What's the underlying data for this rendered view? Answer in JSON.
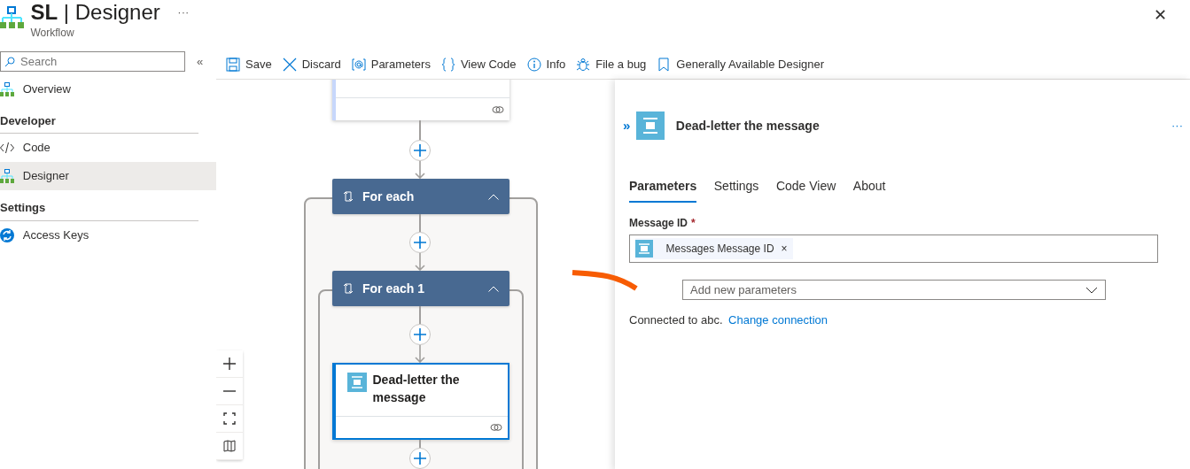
{
  "header": {
    "title_bold": "SL",
    "title_rest": "| Designer",
    "subtitle": "Workflow",
    "more": "···",
    "close": "✕"
  },
  "sidebar": {
    "search_placeholder": "Search",
    "collapse": "«",
    "sections": [
      {
        "items": [
          {
            "label": "Overview",
            "kind": "workflow",
            "selected": false
          }
        ]
      },
      {
        "heading": "Developer",
        "items": [
          {
            "label": "Code",
            "kind": "code",
            "selected": false
          },
          {
            "label": "Designer",
            "kind": "workflow",
            "selected": true
          }
        ]
      },
      {
        "heading": "Settings",
        "items": [
          {
            "label": "Access Keys",
            "kind": "refresh",
            "selected": false
          }
        ]
      }
    ]
  },
  "toolbar": [
    {
      "label": "Save",
      "kind": "save"
    },
    {
      "label": "Discard",
      "kind": "close"
    },
    {
      "label": "Parameters",
      "kind": "at"
    },
    {
      "label": "View Code",
      "kind": "braces"
    },
    {
      "label": "Info",
      "kind": "info"
    },
    {
      "label": "File a bug",
      "kind": "bug"
    },
    {
      "label": "Generally Available Designer",
      "kind": "bookmark"
    }
  ],
  "canvas": {
    "loops": [
      {
        "title": "For each",
        "expanded": true
      },
      {
        "title": "For each 1",
        "expanded": true
      }
    ],
    "action": {
      "title": "Dead-letter the message",
      "selected": true
    }
  },
  "panel": {
    "collapse": "»",
    "title": "Dead-letter the message",
    "more": "···",
    "tabs": [
      {
        "label": "Parameters",
        "selected": true
      },
      {
        "label": "Settings",
        "selected": false
      },
      {
        "label": "Code View",
        "selected": false
      },
      {
        "label": "About",
        "selected": false
      }
    ],
    "field": {
      "label": "Message ID",
      "required_mark": "*",
      "token": "Messages Message ID",
      "remove": "×"
    },
    "add_params_placeholder": "Add new parameters",
    "connection_text": "Connected to abc.",
    "connection_link": "Change connection"
  }
}
